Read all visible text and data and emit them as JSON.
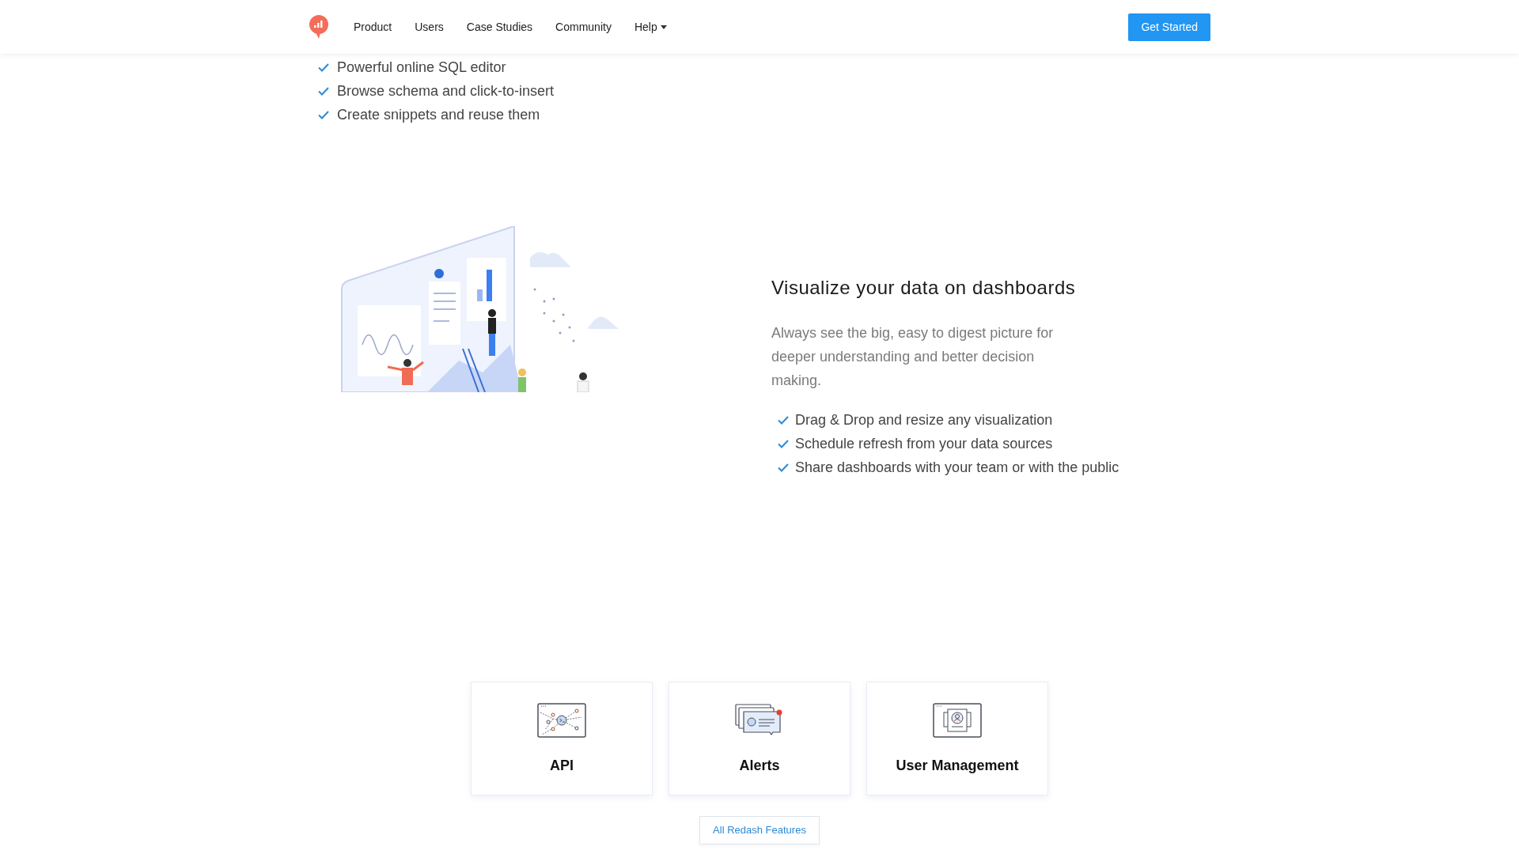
{
  "nav": {
    "items": [
      {
        "label": "Product",
        "dropdown": false
      },
      {
        "label": "Users",
        "dropdown": false
      },
      {
        "label": "Case Studies",
        "dropdown": false
      },
      {
        "label": "Community",
        "dropdown": false
      },
      {
        "label": "Help",
        "dropdown": true
      }
    ],
    "cta": "Get Started"
  },
  "top_features": [
    "Powerful online SQL editor",
    "Browse schema and click-to-insert",
    "Create snippets and reuse them"
  ],
  "section": {
    "title": "Visualize your data on dashboards",
    "description": "Always see the big, easy to digest picture for deeper understanding and better decision making.",
    "features": [
      "Drag & Drop and resize any visualization",
      "Schedule refresh from your data sources",
      "Share dashboards with your team or with the public"
    ]
  },
  "cards": [
    {
      "title": "API",
      "kind": "api"
    },
    {
      "title": "Alerts",
      "kind": "alerts"
    },
    {
      "title": "User Management",
      "kind": "users"
    }
  ],
  "all_features_button": "All Redash Features"
}
